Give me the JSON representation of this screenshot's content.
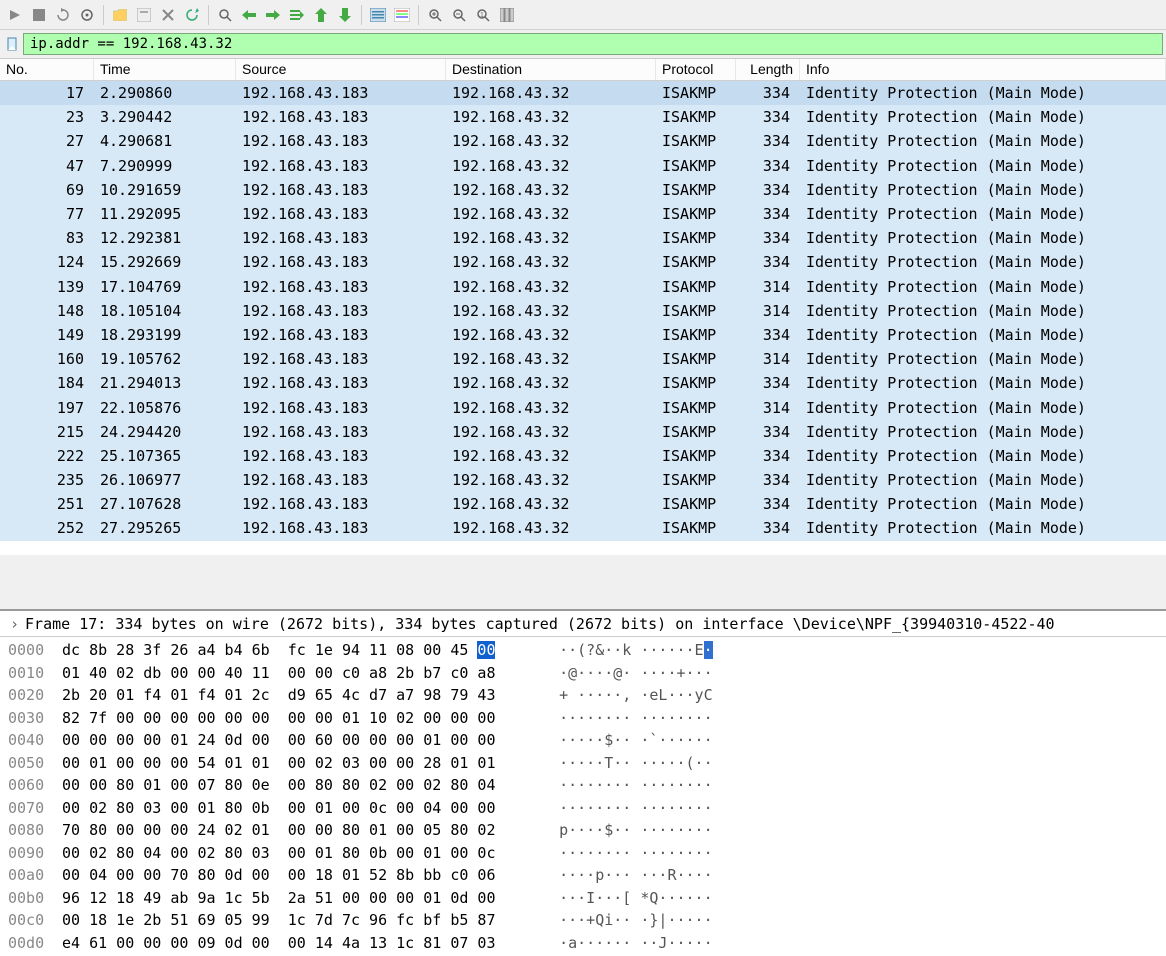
{
  "filter": {
    "value": "ip.addr == 192.168.43.32"
  },
  "columns": {
    "no": "No.",
    "time": "Time",
    "source": "Source",
    "destination": "Destination",
    "protocol": "Protocol",
    "length": "Length",
    "info": "Info"
  },
  "packets": [
    {
      "no": "17",
      "time": "2.290860",
      "src": "192.168.43.183",
      "dst": "192.168.43.32",
      "proto": "ISAKMP",
      "len": "334",
      "info": "Identity Protection (Main Mode)"
    },
    {
      "no": "23",
      "time": "3.290442",
      "src": "192.168.43.183",
      "dst": "192.168.43.32",
      "proto": "ISAKMP",
      "len": "334",
      "info": "Identity Protection (Main Mode)"
    },
    {
      "no": "27",
      "time": "4.290681",
      "src": "192.168.43.183",
      "dst": "192.168.43.32",
      "proto": "ISAKMP",
      "len": "334",
      "info": "Identity Protection (Main Mode)"
    },
    {
      "no": "47",
      "time": "7.290999",
      "src": "192.168.43.183",
      "dst": "192.168.43.32",
      "proto": "ISAKMP",
      "len": "334",
      "info": "Identity Protection (Main Mode)"
    },
    {
      "no": "69",
      "time": "10.291659",
      "src": "192.168.43.183",
      "dst": "192.168.43.32",
      "proto": "ISAKMP",
      "len": "334",
      "info": "Identity Protection (Main Mode)"
    },
    {
      "no": "77",
      "time": "11.292095",
      "src": "192.168.43.183",
      "dst": "192.168.43.32",
      "proto": "ISAKMP",
      "len": "334",
      "info": "Identity Protection (Main Mode)"
    },
    {
      "no": "83",
      "time": "12.292381",
      "src": "192.168.43.183",
      "dst": "192.168.43.32",
      "proto": "ISAKMP",
      "len": "334",
      "info": "Identity Protection (Main Mode)"
    },
    {
      "no": "124",
      "time": "15.292669",
      "src": "192.168.43.183",
      "dst": "192.168.43.32",
      "proto": "ISAKMP",
      "len": "334",
      "info": "Identity Protection (Main Mode)"
    },
    {
      "no": "139",
      "time": "17.104769",
      "src": "192.168.43.183",
      "dst": "192.168.43.32",
      "proto": "ISAKMP",
      "len": "314",
      "info": "Identity Protection (Main Mode)"
    },
    {
      "no": "148",
      "time": "18.105104",
      "src": "192.168.43.183",
      "dst": "192.168.43.32",
      "proto": "ISAKMP",
      "len": "314",
      "info": "Identity Protection (Main Mode)"
    },
    {
      "no": "149",
      "time": "18.293199",
      "src": "192.168.43.183",
      "dst": "192.168.43.32",
      "proto": "ISAKMP",
      "len": "334",
      "info": "Identity Protection (Main Mode)"
    },
    {
      "no": "160",
      "time": "19.105762",
      "src": "192.168.43.183",
      "dst": "192.168.43.32",
      "proto": "ISAKMP",
      "len": "314",
      "info": "Identity Protection (Main Mode)"
    },
    {
      "no": "184",
      "time": "21.294013",
      "src": "192.168.43.183",
      "dst": "192.168.43.32",
      "proto": "ISAKMP",
      "len": "334",
      "info": "Identity Protection (Main Mode)"
    },
    {
      "no": "197",
      "time": "22.105876",
      "src": "192.168.43.183",
      "dst": "192.168.43.32",
      "proto": "ISAKMP",
      "len": "314",
      "info": "Identity Protection (Main Mode)"
    },
    {
      "no": "215",
      "time": "24.294420",
      "src": "192.168.43.183",
      "dst": "192.168.43.32",
      "proto": "ISAKMP",
      "len": "334",
      "info": "Identity Protection (Main Mode)"
    },
    {
      "no": "222",
      "time": "25.107365",
      "src": "192.168.43.183",
      "dst": "192.168.43.32",
      "proto": "ISAKMP",
      "len": "334",
      "info": "Identity Protection (Main Mode)"
    },
    {
      "no": "235",
      "time": "26.106977",
      "src": "192.168.43.183",
      "dst": "192.168.43.32",
      "proto": "ISAKMP",
      "len": "334",
      "info": "Identity Protection (Main Mode)"
    },
    {
      "no": "251",
      "time": "27.107628",
      "src": "192.168.43.183",
      "dst": "192.168.43.32",
      "proto": "ISAKMP",
      "len": "334",
      "info": "Identity Protection (Main Mode)"
    },
    {
      "no": "252",
      "time": "27.295265",
      "src": "192.168.43.183",
      "dst": "192.168.43.32",
      "proto": "ISAKMP",
      "len": "334",
      "info": "Identity Protection (Main Mode)"
    }
  ],
  "details": {
    "frame_line": "Frame 17: 334 bytes on wire (2672 bits), 334 bytes captured (2672 bits) on interface \\Device\\NPF_{39940310-4522-40"
  },
  "hex": [
    {
      "off": "0000",
      "b": "dc 8b 28 3f 26 a4 b4 6b  fc 1e 94 11 08 00 45 ",
      "hl": "00",
      "a": "··(?&··k ······E",
      "ahl": "·"
    },
    {
      "off": "0010",
      "b": "01 40 02 db 00 00 40 11  00 00 c0 a8 2b b7 c0 a8",
      "a": "·@····@· ····+···"
    },
    {
      "off": "0020",
      "b": "2b 20 01 f4 01 f4 01 2c  d9 65 4c d7 a7 98 79 43",
      "a": "+ ·····, ·eL···yC"
    },
    {
      "off": "0030",
      "b": "82 7f 00 00 00 00 00 00  00 00 01 10 02 00 00 00",
      "a": "········ ········"
    },
    {
      "off": "0040",
      "b": "00 00 00 00 01 24 0d 00  00 60 00 00 00 01 00 00",
      "a": "·····$·· ·`······"
    },
    {
      "off": "0050",
      "b": "00 01 00 00 00 54 01 01  00 02 03 00 00 28 01 01",
      "a": "·····T·· ·····(··"
    },
    {
      "off": "0060",
      "b": "00 00 80 01 00 07 80 0e  00 80 80 02 00 02 80 04",
      "a": "········ ········"
    },
    {
      "off": "0070",
      "b": "00 02 80 03 00 01 80 0b  00 01 00 0c 00 04 00 00",
      "a": "········ ········"
    },
    {
      "off": "0080",
      "b": "70 80 00 00 00 24 02 01  00 00 80 01 00 05 80 02",
      "a": "p····$·· ········"
    },
    {
      "off": "0090",
      "b": "00 02 80 04 00 02 80 03  00 01 80 0b 00 01 00 0c",
      "a": "········ ········"
    },
    {
      "off": "00a0",
      "b": "00 04 00 00 70 80 0d 00  00 18 01 52 8b bb c0 06",
      "a": "····p··· ···R····"
    },
    {
      "off": "00b0",
      "b": "96 12 18 49 ab 9a 1c 5b  2a 51 00 00 00 01 0d 00",
      "a": "···I···[ *Q······"
    },
    {
      "off": "00c0",
      "b": "00 18 1e 2b 51 69 05 99  1c 7d 7c 96 fc bf b5 87",
      "a": "···+Qi·· ·}|·····"
    },
    {
      "off": "00d0",
      "b": "e4 61 00 00 00 09 0d 00  00 14 4a 13 1c 81 07 03",
      "a": "·a······ ··J·····"
    }
  ]
}
